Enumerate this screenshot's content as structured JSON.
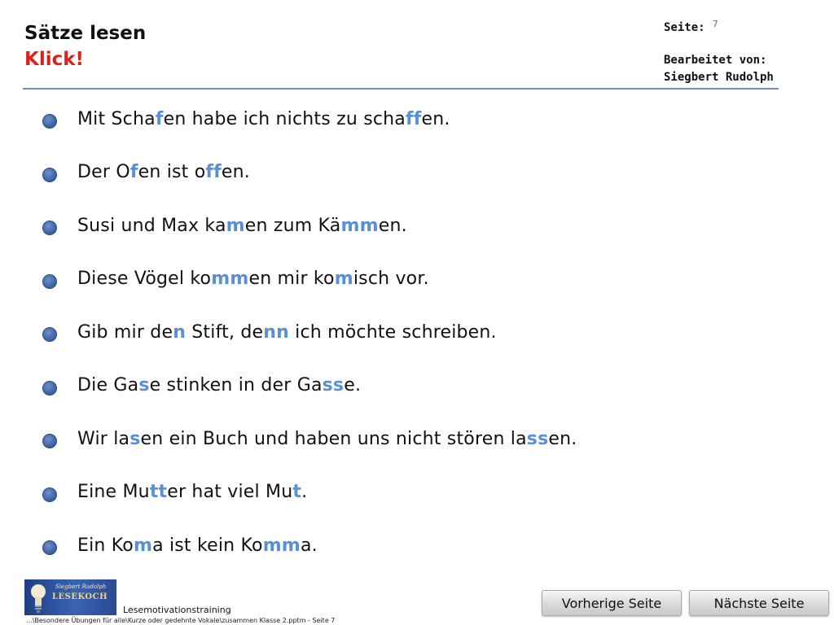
{
  "header": {
    "title": "Sätze lesen",
    "subtitle": "Klick!",
    "page_label": "Seite:",
    "page_number": "7",
    "edited_by_label": "Bearbeitet von:",
    "edited_by_name": "Siegbert Rudolph"
  },
  "colors": {
    "accent": "#5a8fd8",
    "subtitle": "#e0201a",
    "rule": "#6d8ec2",
    "bullet": "#3f66a6"
  },
  "sentences": [
    {
      "parts": [
        {
          "t": "Mit Scha"
        },
        {
          "t": "f",
          "h": true
        },
        {
          "t": "en habe ich nichts zu scha"
        },
        {
          "t": "ff",
          "h": true
        },
        {
          "t": "en."
        }
      ]
    },
    {
      "parts": [
        {
          "t": "Der O"
        },
        {
          "t": "f",
          "h": true
        },
        {
          "t": "en ist o"
        },
        {
          "t": "ff",
          "h": true
        },
        {
          "t": "en."
        }
      ]
    },
    {
      "parts": [
        {
          "t": "Susi und Max ka"
        },
        {
          "t": "m",
          "h": true
        },
        {
          "t": "en zum Kä"
        },
        {
          "t": "mm",
          "h": true
        },
        {
          "t": "en."
        }
      ]
    },
    {
      "parts": [
        {
          "t": "Diese Vögel ko"
        },
        {
          "t": "mm",
          "h": true
        },
        {
          "t": "en mir ko"
        },
        {
          "t": "m",
          "h": true
        },
        {
          "t": "isch vor."
        }
      ]
    },
    {
      "parts": [
        {
          "t": "Gib mir de"
        },
        {
          "t": "n",
          "h": true
        },
        {
          "t": " Stift, de"
        },
        {
          "t": "nn",
          "h": true
        },
        {
          "t": " ich möchte schreiben."
        }
      ]
    },
    {
      "parts": [
        {
          "t": "Die Ga"
        },
        {
          "t": "s",
          "h": true
        },
        {
          "t": "e stinken in der Ga"
        },
        {
          "t": "ss",
          "h": true
        },
        {
          "t": "e."
        }
      ]
    },
    {
      "parts": [
        {
          "t": "Wir la"
        },
        {
          "t": "s",
          "h": true
        },
        {
          "t": "en ein Buch und haben uns nicht stören la"
        },
        {
          "t": "ss",
          "h": true
        },
        {
          "t": "en."
        }
      ]
    },
    {
      "parts": [
        {
          "t": "Eine Mu"
        },
        {
          "t": "tt",
          "h": true
        },
        {
          "t": "er hat viel Mu"
        },
        {
          "t": "t",
          "h": true
        },
        {
          "t": "."
        }
      ]
    },
    {
      "parts": [
        {
          "t": "Ein Ko"
        },
        {
          "t": "m",
          "h": true
        },
        {
          "t": "a ist kein Ko"
        },
        {
          "t": "mm",
          "h": true
        },
        {
          "t": "a."
        }
      ]
    }
  ],
  "footer": {
    "logo_text_top": "Siegbert Rudolph",
    "logo_text_main": "LESEKOCH",
    "title": "Lesemotivationstraining",
    "path": "...\\Besondere Übungen für alle\\Kurze oder gedehnte Vokale\\zusammen Klasse 2.pptm - Seite 7"
  },
  "nav": {
    "prev_label": "Vorherige Seite",
    "next_label": "Nächste Seite"
  }
}
